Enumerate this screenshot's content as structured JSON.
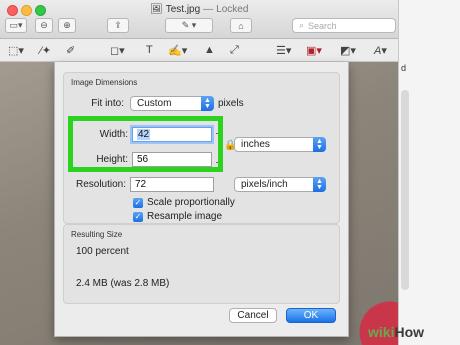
{
  "window": {
    "title": "Test.jpg",
    "title_sep": "—",
    "status": "Locked"
  },
  "search": {
    "placeholder": "Search",
    "icon": "search-icon"
  },
  "right_panel": {
    "letter": "d"
  },
  "dialog": {
    "image_dimensions": {
      "title": "Image Dimensions",
      "fit_label": "Fit into:",
      "fit_value": "Custom",
      "fit_unit": "pixels",
      "width_label": "Width:",
      "width_value": "42",
      "height_label": "Height:",
      "height_value": "56",
      "size_unit": "inches",
      "resolution_label": "Resolution:",
      "resolution_value": "72",
      "resolution_unit": "pixels/inch",
      "scale_label": "Scale proportionally",
      "scale_checked": true,
      "resample_label": "Resample image",
      "resample_checked": true
    },
    "resulting_size": {
      "title": "Resulting Size",
      "percent": "100 percent",
      "file_size": "2.4 MB (was 2.8 MB)"
    },
    "buttons": {
      "cancel": "Cancel",
      "ok": "OK"
    }
  },
  "colors": {
    "highlight": "#2bd21f",
    "accent": "#1a73e8"
  },
  "watermark": {
    "part1": "wiki",
    "part2": "How"
  }
}
